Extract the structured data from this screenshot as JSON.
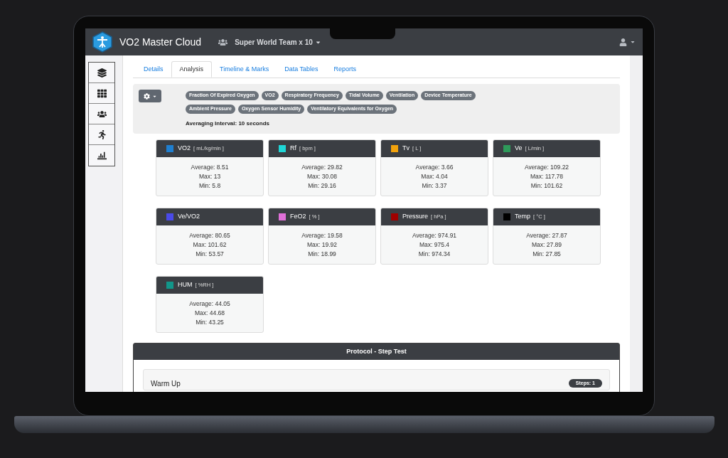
{
  "header": {
    "app_title": "VO2 Master Cloud",
    "team": "Super World Team x 10"
  },
  "tabs": [
    {
      "label": "Details",
      "selected": false
    },
    {
      "label": "Analysis",
      "selected": true
    },
    {
      "label": "Timeline & Marks",
      "selected": false
    },
    {
      "label": "Data Tables",
      "selected": false
    },
    {
      "label": "Reports",
      "selected": false
    }
  ],
  "metric_tags": [
    "Fraction Of Expired Oxygen",
    "VO2",
    "Respiratory Frequency",
    "Tidal Volume",
    "Ventilation",
    "Device Temperature",
    "Ambient Pressure",
    "Oxygen Sensor Humidity",
    "Ventilatory Equivalents for Oxygen"
  ],
  "averaging_interval": "Averaging Interval: 10 seconds",
  "metrics": [
    {
      "name": "VO2",
      "unit": "[ mL/kg/min ]",
      "color": "#1f7fd0",
      "lines": [
        "Average: 8.51",
        "Max: 13",
        "Min: 5.8"
      ]
    },
    {
      "name": "Rf",
      "unit": "[ bpm ]",
      "color": "#1fd6d6",
      "lines": [
        "Average: 29.82",
        "Max: 30.08",
        "Min: 29.16"
      ]
    },
    {
      "name": "Tv",
      "unit": "[ L ]",
      "color": "#f2a20c",
      "lines": [
        "Average: 3.66",
        "Max: 4.04",
        "Min: 3.37"
      ]
    },
    {
      "name": "Ve",
      "unit": "[ L/min ]",
      "color": "#2e9a5a",
      "lines": [
        "Average: 109.22",
        "Max: 117.78",
        "Min: 101.62"
      ]
    },
    {
      "name": "Ve/VO2",
      "color": "#4a4ae8",
      "lines": [
        "Average: 80.65",
        "Max: 101.62",
        "Min: 53.57"
      ]
    },
    {
      "name": "FeO2",
      "unit": "[ % ]",
      "color": "#e070d8",
      "lines": [
        "Average: 19.58",
        "Max: 19.92",
        "Min: 18.99"
      ]
    },
    {
      "name": "Pressure",
      "unit": "[ hPa ]",
      "color": "#a00000",
      "lines": [
        "Average: 974.91",
        "Max: 975.4",
        "Min: 974.34"
      ]
    },
    {
      "name": "Temp",
      "unit": "[ °C ]",
      "color": "#000000",
      "lines": [
        "Average: 27.87",
        "Max: 27.89",
        "Min: 27.85"
      ]
    },
    {
      "name": "HUM",
      "unit": "[ %RH ]",
      "color": "#12968a",
      "lines": [
        "Average: 44.05",
        "Max: 44.68",
        "Min: 43.25"
      ]
    }
  ],
  "protocol": {
    "title": "Protocol - Step Test",
    "stages": [
      {
        "name": "Warm Up",
        "badge": "Steps: 1"
      }
    ]
  }
}
